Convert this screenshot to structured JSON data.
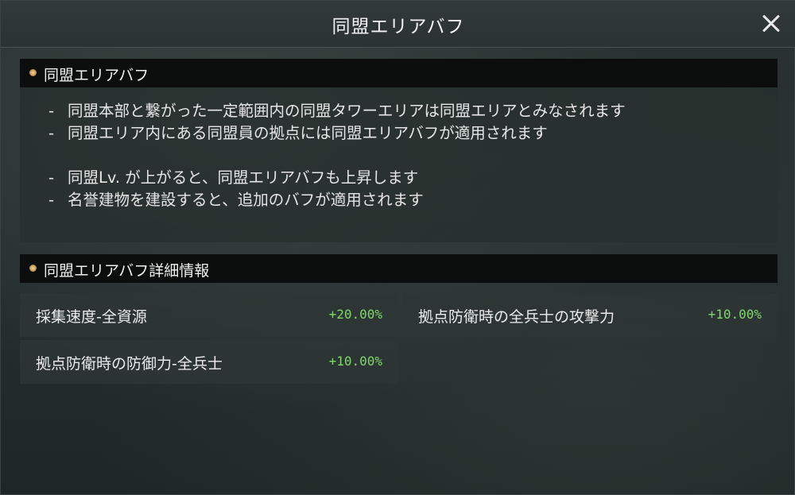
{
  "dialog": {
    "title": "同盟エリアバフ"
  },
  "section1": {
    "title": "同盟エリアバフ",
    "lines": [
      "同盟本部と繋がった一定範囲内の同盟タワーエリアは同盟エリアとみなされます",
      "同盟エリア内にある同盟員の拠点には同盟エリアバフが適用されます",
      "同盟Lv. が上がると、同盟エリアバフも上昇します",
      "名誉建物を建設すると、追加のバフが適用されます"
    ],
    "dash": "-"
  },
  "section2": {
    "title": "同盟エリアバフ詳細情報",
    "stats": [
      {
        "name": "採集速度-全資源",
        "value": "+20.00%"
      },
      {
        "name": "拠点防衛時の全兵士の攻撃力",
        "value": "+10.00%"
      },
      {
        "name": "拠点防衛時の防御力-全兵士",
        "value": "+10.00%"
      }
    ]
  },
  "icons": {
    "close": "close-icon",
    "bullet": "bullet-dot-icon"
  },
  "colors": {
    "value_green": "#7fd86b",
    "bullet_gold": "#c99a5a"
  }
}
